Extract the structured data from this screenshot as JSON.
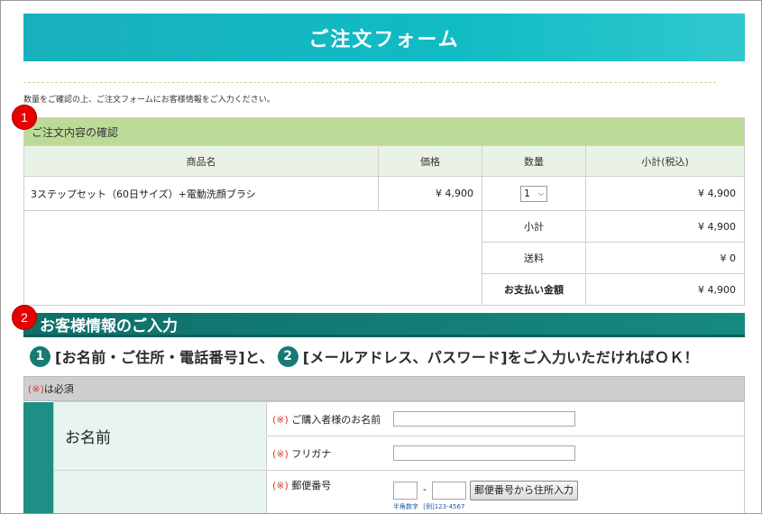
{
  "banner_title": "ご注文フォーム",
  "intro_text": "数量をご確認の上、ご注文フォームにお客様情報をご入力ください。",
  "markers": [
    "1",
    "2"
  ],
  "order": {
    "title": "ご注文内容の確認",
    "headers": [
      "商品名",
      "価格",
      "数量",
      "小計(税込)"
    ],
    "item": {
      "name": "3ステップセット（60日サイズ）+電動洗顔ブラシ",
      "price": "¥ 4,900",
      "qty": "1",
      "subtotal": "¥ 4,900"
    },
    "summary": [
      {
        "label": "小計",
        "value": "¥ 4,900"
      },
      {
        "label": "送料",
        "value": "¥ 0"
      },
      {
        "label": "お支払い金額",
        "value": "¥ 4,900"
      }
    ]
  },
  "customer": {
    "heading": "お客様情報のご入力",
    "guide_num1": "1",
    "guide_text1": "[お名前・ご住所・電話番号]と、",
    "guide_num2": "2",
    "guide_text2": "[メールアドレス、パスワード]をご入力いただければＯＫ！",
    "required_mark": "(※)",
    "required_text": "は必須",
    "name_label": "お名前",
    "field_name": "ご購入者様のお名前",
    "field_kana": "フリガナ",
    "field_zip": "郵便番号",
    "zip_dash": "-",
    "zip_button": "郵便番号から住所入力",
    "zip_note_a": "半角数字",
    "zip_note_b": "[例]123-4567"
  },
  "colors": {
    "banner": "#10bcc4",
    "green_header": "#bddb98",
    "section": "#158a81",
    "marker": "#e60000"
  }
}
